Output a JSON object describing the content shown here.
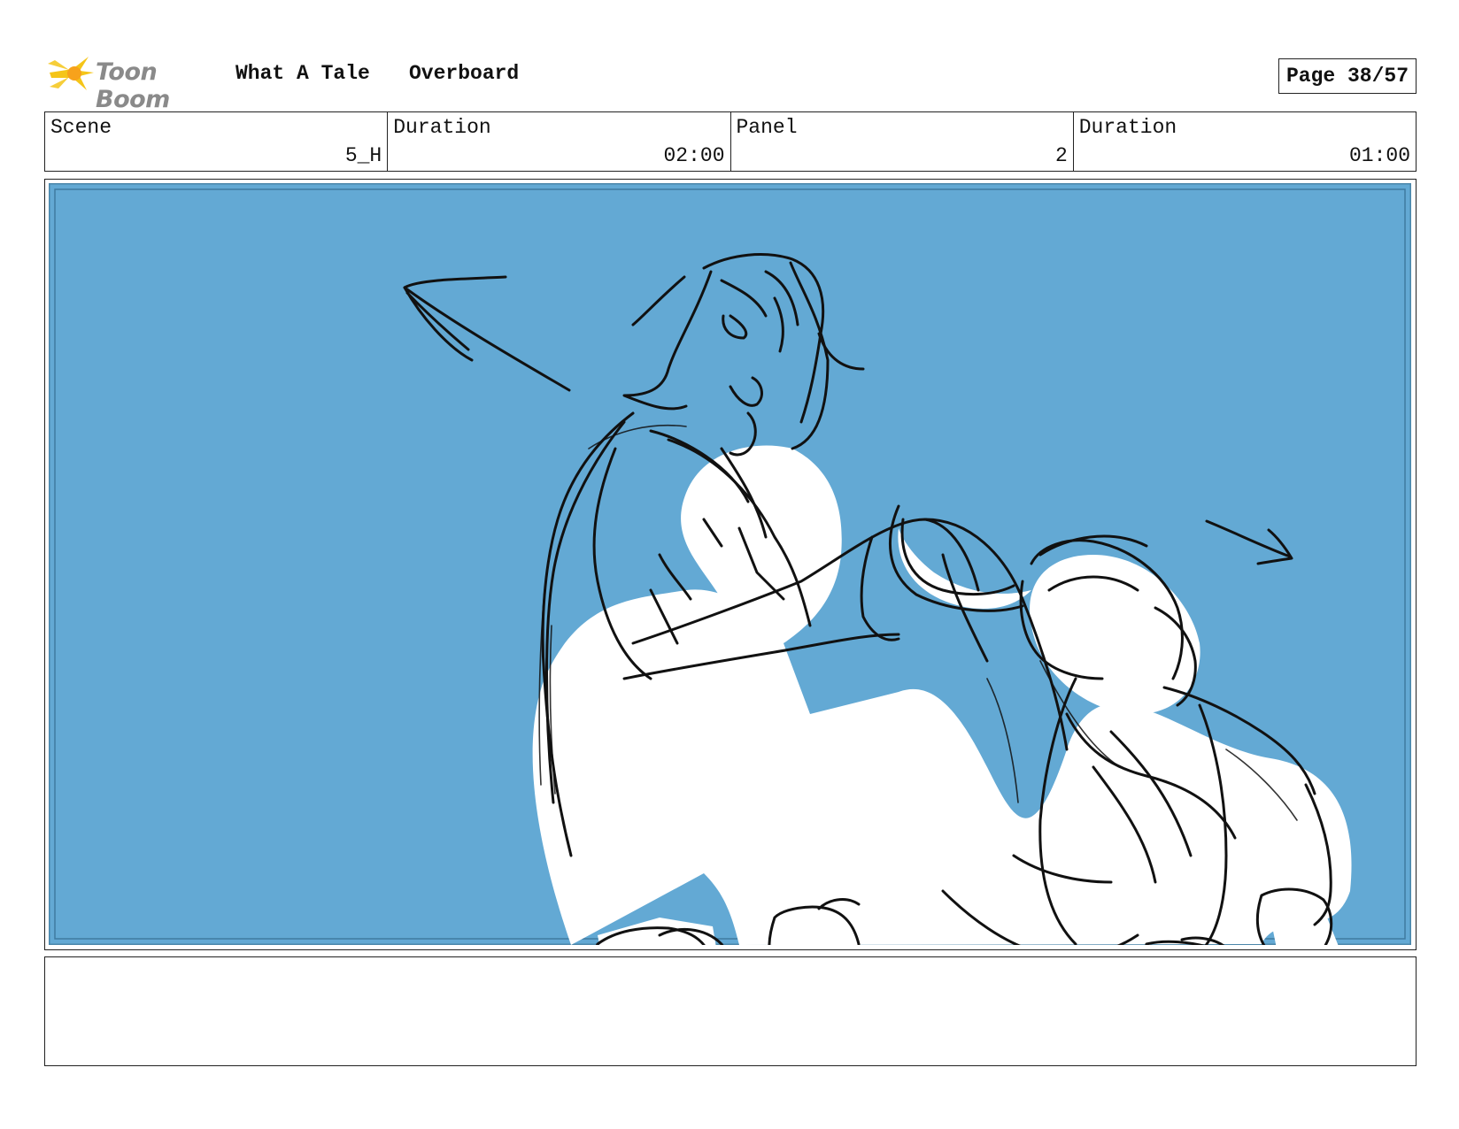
{
  "header": {
    "logo_text": "Toon Boom",
    "project_title": "What A Tale",
    "episode_title": "Overboard",
    "page_label": "Page 38/57"
  },
  "info": {
    "scene_label": "Scene",
    "scene_value": "5_H",
    "scene_duration_label": "Duration",
    "scene_duration_value": "02:00",
    "panel_label": "Panel",
    "panel_value": "2",
    "panel_duration_label": "Duration",
    "panel_duration_value": "01:00"
  },
  "colors": {
    "sky": "#63a9d4",
    "logo_yellow": "#f5c518",
    "ink": "#111111"
  },
  "caption": ""
}
